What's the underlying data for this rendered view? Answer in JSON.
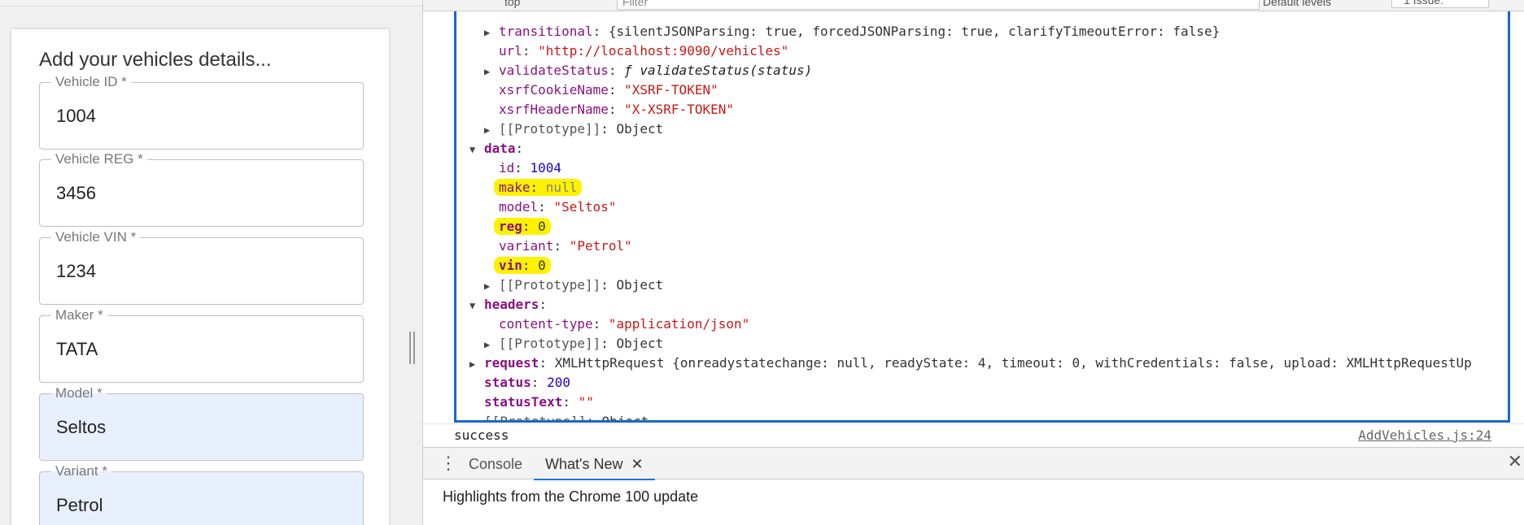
{
  "form": {
    "title": "Add your vehicles details...",
    "fields": [
      {
        "label": "Vehicle ID *",
        "value": "1004"
      },
      {
        "label": "Vehicle REG *",
        "value": "3456"
      },
      {
        "label": "Vehicle VIN *",
        "value": "1234"
      },
      {
        "label": "Maker *",
        "value": "TATA"
      },
      {
        "label": "Model *",
        "value": "Seltos"
      },
      {
        "label": "Variant *",
        "value": "Petrol"
      }
    ]
  },
  "devtools": {
    "filter_placeholder": "Filter",
    "context": "top",
    "levels": "Default levels",
    "issues": "1 Issue:",
    "object": {
      "transitional_key": "transitional",
      "transitional_val": "{silentJSONParsing: true, forcedJSONParsing: true, clarifyTimeoutError: false}",
      "url_key": "url",
      "url_val": "\"http://localhost:9090/vehicles\"",
      "validate_key": "validateStatus",
      "validate_val": "ƒ validateStatus(status)",
      "xsrf_cookie_key": "xsrfCookieName",
      "xsrf_cookie_val": "\"XSRF-TOKEN\"",
      "xsrf_header_key": "xsrfHeaderName",
      "xsrf_header_val": "\"X-XSRF-TOKEN\"",
      "prototype_key": "[[Prototype]]",
      "prototype_val": "Object",
      "data_key": "data",
      "id_key": "id",
      "id_val": "1004",
      "make_key": "make",
      "make_val": "null",
      "model_key": "model",
      "model_val": "\"Seltos\"",
      "reg_key": "reg",
      "reg_val": "0",
      "variant_key": "variant",
      "variant_val": "\"Petrol\"",
      "vin_key": "vin",
      "vin_val": "0",
      "headers_key": "headers",
      "content_type_key": "content-type",
      "content_type_val": "\"application/json\"",
      "request_key": "request",
      "request_val": "XMLHttpRequest {onreadystatechange: null, readyState: 4, timeout: 0, withCredentials: false, upload: XMLHttpRequestUp",
      "status_key": "status",
      "status_val": "200",
      "status_text_key": "statusText",
      "status_text_val": "\"\""
    },
    "message": "success",
    "message_source": "AddVehicles.js:24",
    "drawer": {
      "tab_console": "Console",
      "tab_whatsnew": "What's New",
      "close_glyph": "✕",
      "whatsnew_text": "Highlights from the Chrome 100 update"
    }
  }
}
